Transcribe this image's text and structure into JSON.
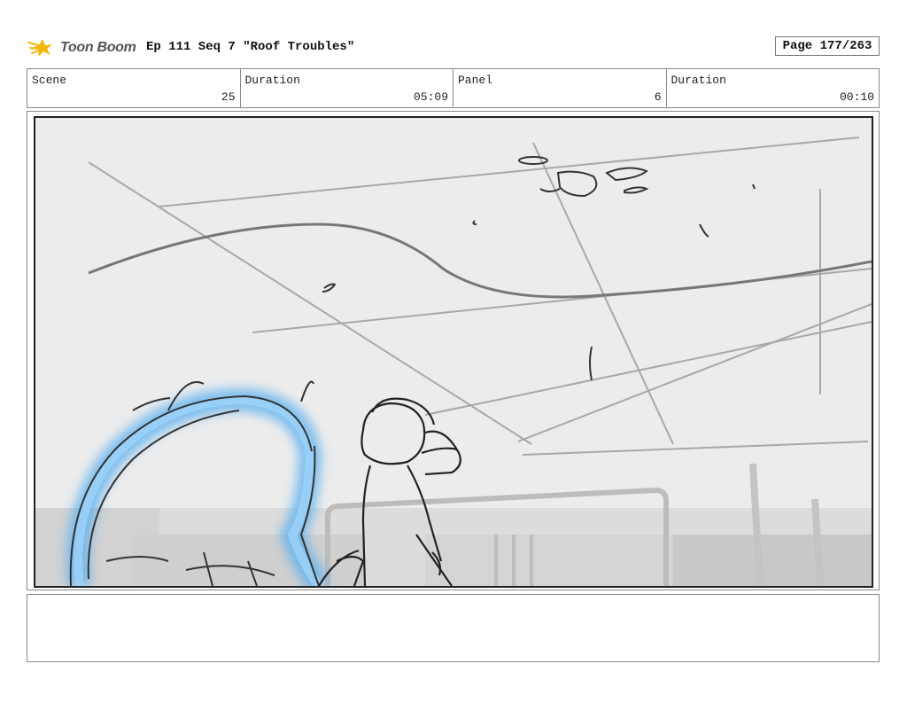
{
  "header": {
    "logo_text": "Toon Boom",
    "title": "Ep 111 Seq 7 \"Roof Troubles\"",
    "page": "Page 177/263"
  },
  "info": {
    "scene_label": "Scene",
    "scene_value": "25",
    "scene_duration_label": "Duration",
    "scene_duration_value": "05:09",
    "panel_label": "Panel",
    "panel_value": "6",
    "panel_duration_label": "Duration",
    "panel_duration_value": "00:10"
  },
  "notes": {
    "text": ""
  }
}
